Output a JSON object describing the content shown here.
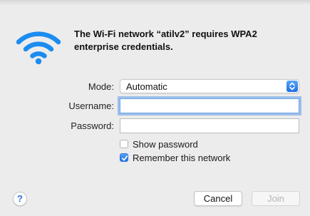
{
  "dialog": {
    "message": "The Wi-Fi network “atilv2” requires WPA2 enterprise credentials."
  },
  "form": {
    "mode_label": "Mode:",
    "mode_value": "Automatic",
    "username_label": "Username:",
    "username_value": "",
    "password_label": "Password:",
    "password_value": ""
  },
  "options": {
    "show_password_label": "Show password",
    "show_password_checked": false,
    "remember_label": "Remember this network",
    "remember_checked": true
  },
  "buttons": {
    "help_glyph": "?",
    "cancel_label": "Cancel",
    "join_label": "Join",
    "join_enabled": false
  },
  "colors": {
    "accent": "#1f6fe3",
    "wifi_icon": "#1b8cf0",
    "background": "#ececec"
  },
  "icons": {
    "network": "wifi-icon",
    "select": "chevron-up-down-icon",
    "check": "checkmark-icon"
  }
}
